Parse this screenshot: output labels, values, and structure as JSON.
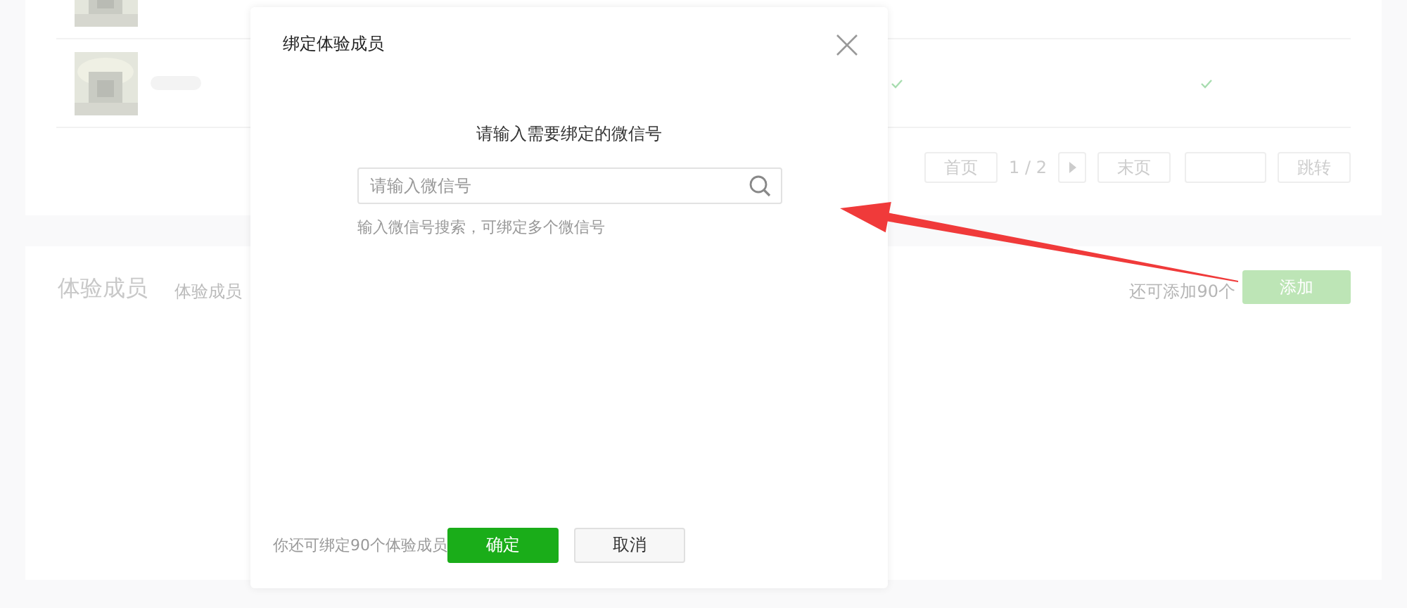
{
  "members_list": {
    "pagination": {
      "first": "首页",
      "page": "1 / 2",
      "last": "末页",
      "jump": "跳转"
    }
  },
  "members_section": {
    "title": "体验成员",
    "subtitle": "体验成员",
    "remaining": "还可添加90个",
    "add_button": "添加"
  },
  "dialog": {
    "title": "绑定体验成员",
    "prompt": "请输入需要绑定的微信号",
    "search": {
      "placeholder": "请输入微信号"
    },
    "hint": "输入微信号搜索，可绑定多个微信号",
    "footer_note": "你还可绑定90个体验成员",
    "buttons": [
      {
        "label": "确定",
        "kind": "primary"
      },
      {
        "label": "取消",
        "kind": "default"
      }
    ]
  }
}
